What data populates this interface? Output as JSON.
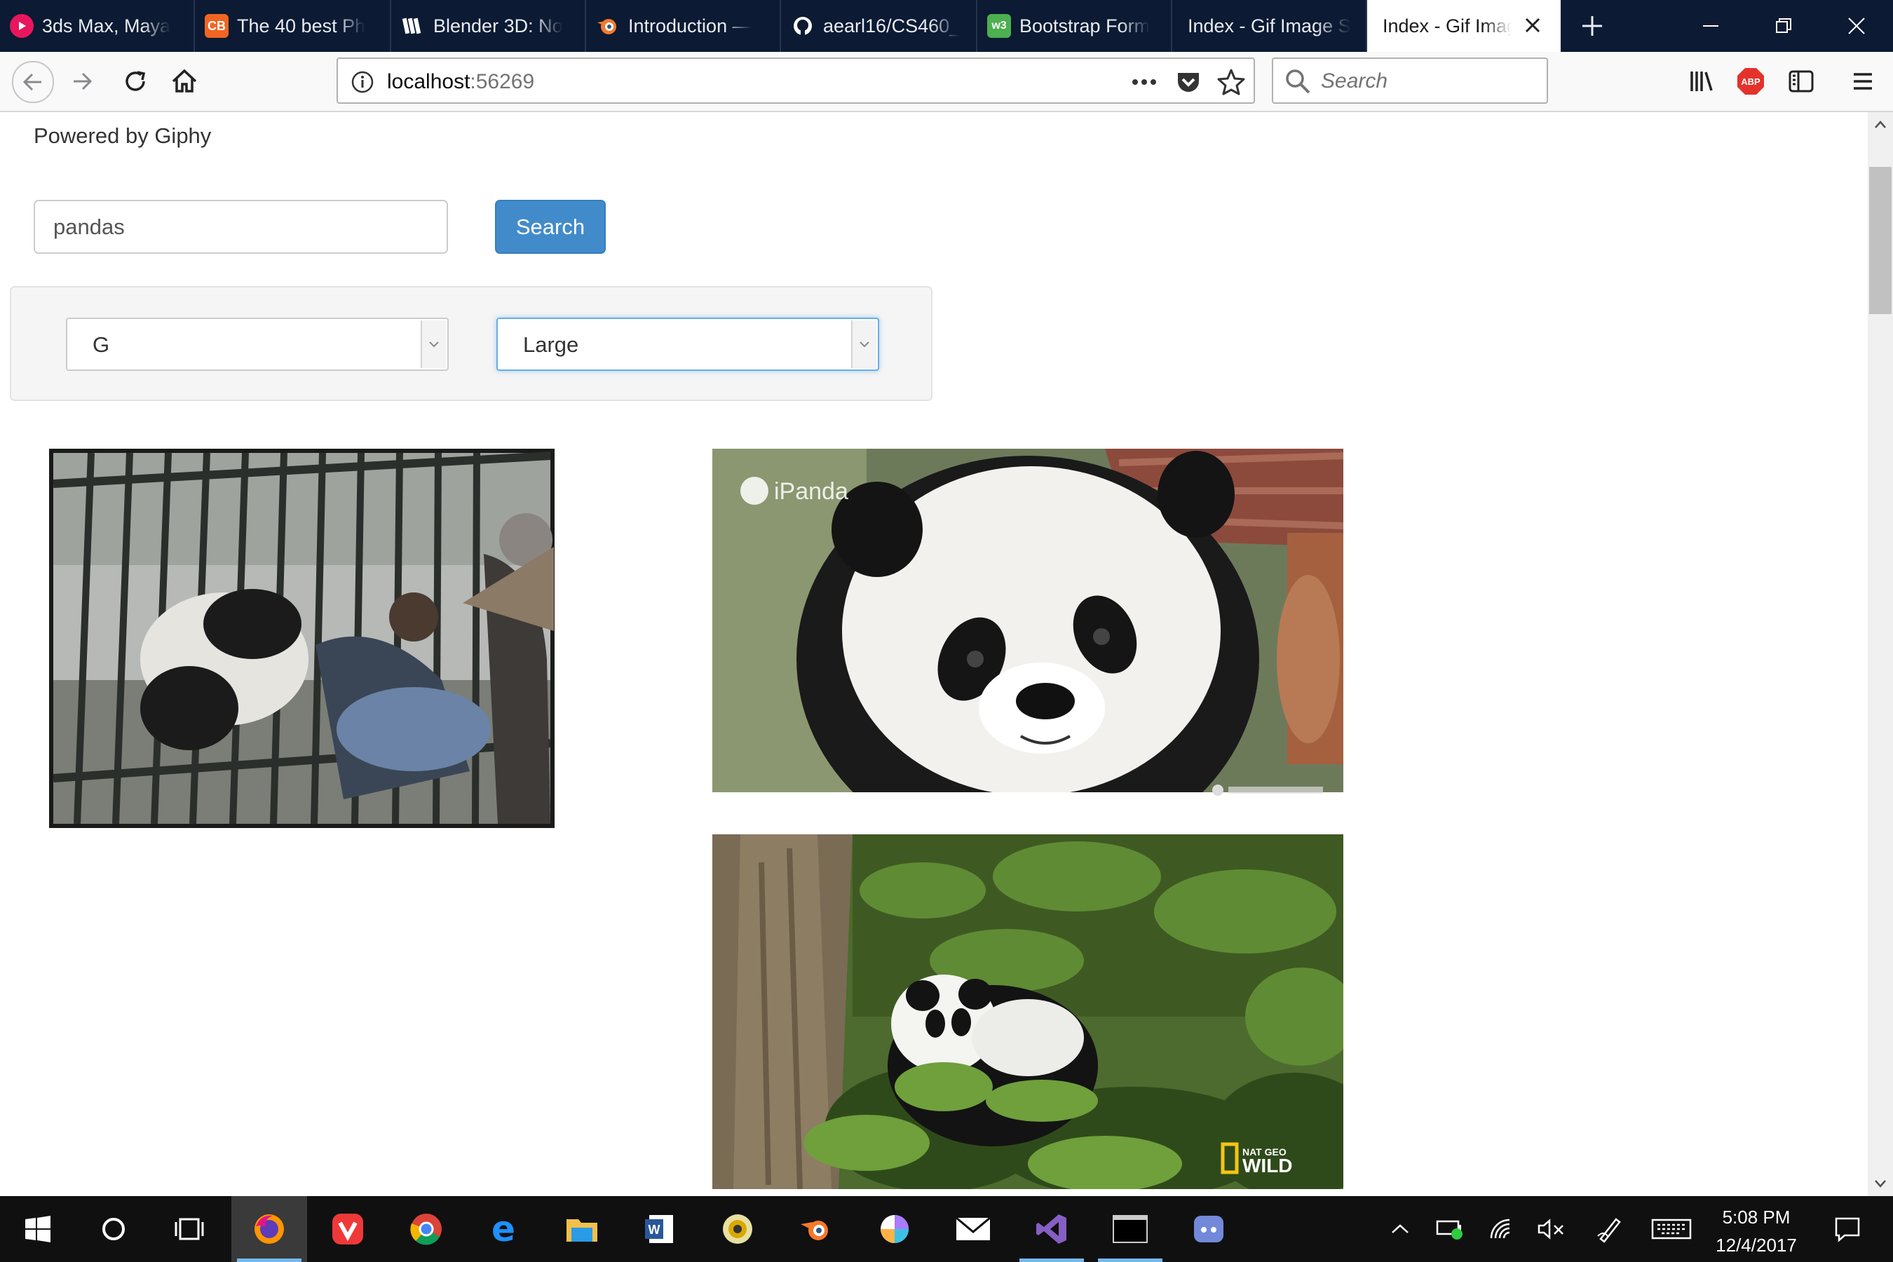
{
  "browser": {
    "tabs": [
      {
        "label": "3ds Max, Maya",
        "favicon": "red-play-icon",
        "color": "#e8175d"
      },
      {
        "label": "The 40 best Ph",
        "favicon": "cb-icon",
        "color": "#f26522"
      },
      {
        "label": "Blender 3D: No",
        "favicon": "wikibooks-icon",
        "color": "#ffffff"
      },
      {
        "label": "Introduction —",
        "favicon": "blender-icon",
        "color": "#f5792a"
      },
      {
        "label": "aearl16/CS460_",
        "favicon": "github-icon",
        "color": "#ffffff"
      },
      {
        "label": "Bootstrap Form",
        "favicon": "w3-icon",
        "color": "#4caf50"
      },
      {
        "label": "Index - Gif Image S",
        "favicon": "",
        "color": ""
      },
      {
        "label": "Index - Gif Imag",
        "favicon": "",
        "color": "",
        "active": true
      }
    ],
    "url": {
      "host": "localhost",
      "port": ":56269"
    },
    "search_placeholder": "Search",
    "toolbar": {
      "adblock_label": "ABP"
    }
  },
  "page": {
    "powered_by": "Powered by Giphy",
    "search": {
      "query": "pandas",
      "button_label": "Search"
    },
    "filters": {
      "rating": "G",
      "size": "Large"
    },
    "gifs": [
      {
        "caption": ""
      },
      {
        "caption": "iPanda"
      },
      {
        "caption": "NAT GEO WILD"
      }
    ]
  },
  "taskbar": {
    "apps": [
      "start-icon",
      "cortana-icon",
      "task-view-icon",
      "firefox-icon",
      "vivaldi-icon",
      "chrome-icon",
      "edge-icon",
      "file-explorer-icon",
      "word-icon",
      "media-player-icon",
      "blender-icon",
      "paint-icon",
      "mail-icon",
      "visual-studio-icon",
      "terminal-icon",
      "discord-icon"
    ],
    "time": "5:08 PM",
    "date": "12/4/2017"
  },
  "colors": {
    "tabbar": "#0c1a33",
    "primary_button": "#428bca",
    "focus_ring": "#66afe9",
    "taskbar": "#101010"
  }
}
